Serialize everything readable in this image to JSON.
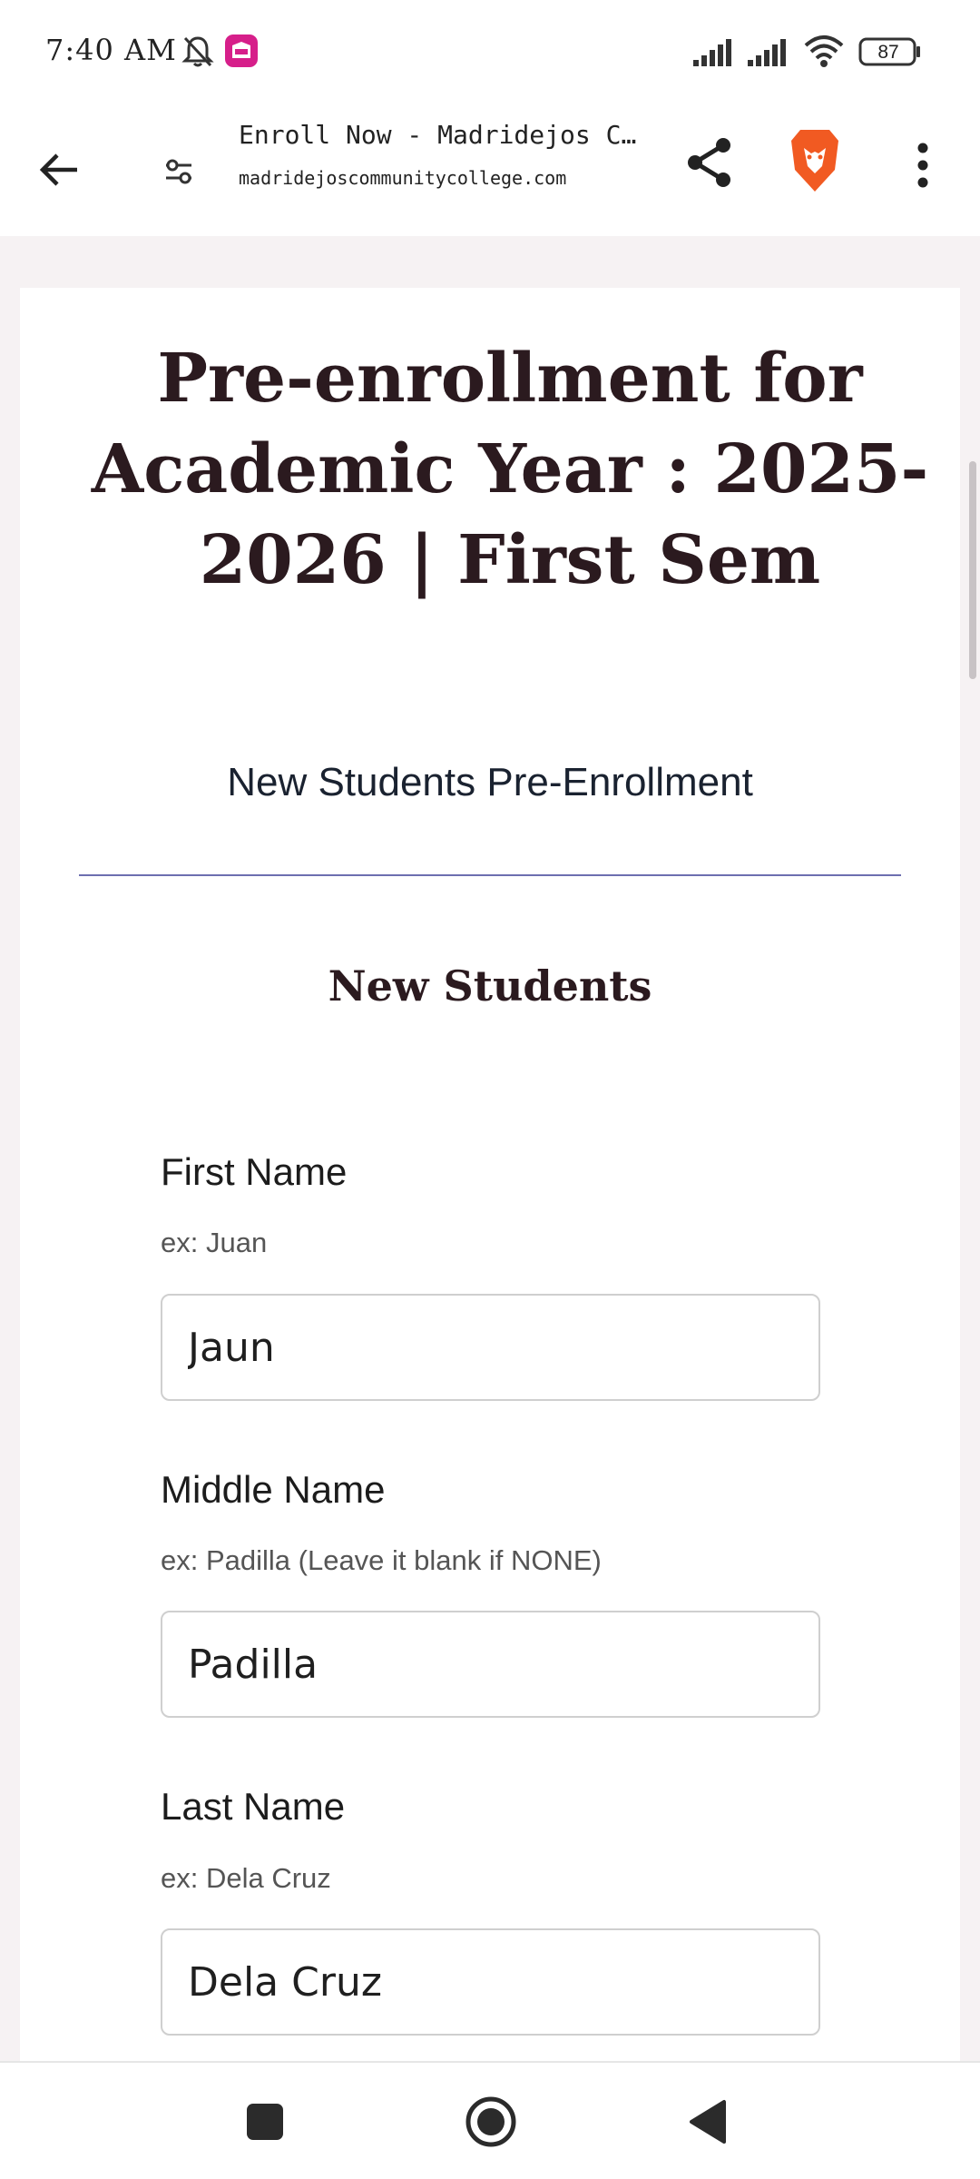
{
  "status_bar": {
    "time": "7:40 AM",
    "battery": "87",
    "icons": [
      "bell-off-icon",
      "lazada-app-icon",
      "signal-icon",
      "signal-icon",
      "wifi-icon",
      "battery-icon"
    ]
  },
  "browser": {
    "page_title": "Enroll Now - Madridejos C···",
    "url": "madridejoscommunitycollege.com",
    "icons": [
      "back-arrow-icon",
      "site-settings-icon",
      "share-icon",
      "brave-lion-icon",
      "more-vert-icon"
    ]
  },
  "page": {
    "title": "Pre-enrollment for Academic Year : 2025-2026 | First Sem",
    "subtitle": "New Students Pre-Enrollment",
    "section_title": "New Students",
    "fields": [
      {
        "label": "First Name",
        "hint": "ex: Juan",
        "value": "Jaun"
      },
      {
        "label": "Middle Name",
        "hint": "ex: Padilla (Leave it blank if NONE)",
        "value": "Padilla"
      },
      {
        "label": "Last Name",
        "hint": "ex: Dela Cruz",
        "value": "Dela Cruz"
      }
    ]
  },
  "colors": {
    "title": "#2b1a1f",
    "divider": "#6d6fb0",
    "page_background": "#f6f2f3",
    "brave_orange": "#f15a22"
  },
  "nav_bar": {
    "icons": [
      "recents-square-icon",
      "home-circle-icon",
      "back-triangle-icon"
    ]
  }
}
